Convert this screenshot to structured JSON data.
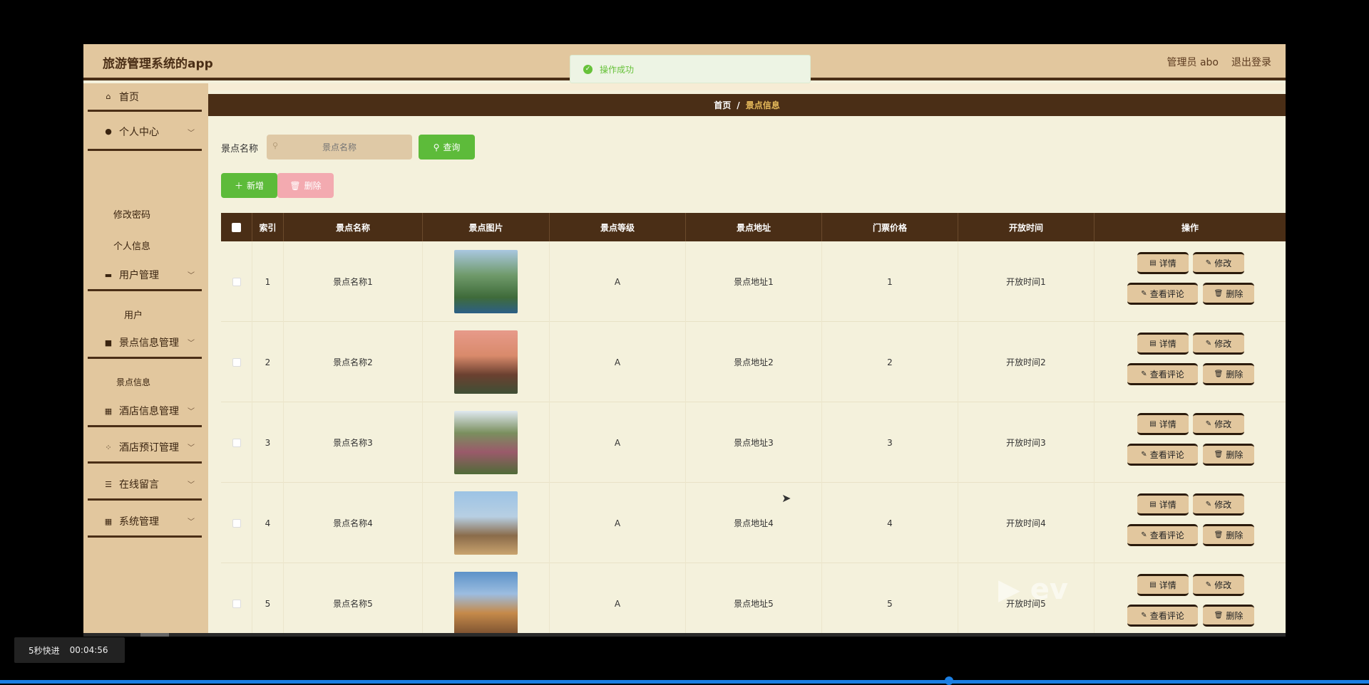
{
  "header": {
    "title": "旅游管理系统的app",
    "user_label": "管理员 abo",
    "logout": "退出登录"
  },
  "toast": {
    "message": "操作成功"
  },
  "sidebar": {
    "items": [
      {
        "label": "首页",
        "icon": "home-icon"
      },
      {
        "label": "个人中心",
        "icon": "user-icon",
        "children": [
          "修改密码",
          "个人信息"
        ]
      },
      {
        "label": "用户管理",
        "icon": "chat-icon",
        "children": [
          "用户"
        ]
      },
      {
        "label": "景点信息管理",
        "icon": "bag-icon",
        "children": [
          "景点信息"
        ]
      },
      {
        "label": "酒店信息管理",
        "icon": "grid-icon"
      },
      {
        "label": "酒店预订管理",
        "icon": "apps-icon"
      },
      {
        "label": "在线留言",
        "icon": "list-icon"
      },
      {
        "label": "系统管理",
        "icon": "grid-icon"
      }
    ]
  },
  "breadcrumb": {
    "home": "首页",
    "sep": "/",
    "current": "景点信息"
  },
  "search": {
    "label": "景点名称",
    "placeholder": "景点名称",
    "button": "查询"
  },
  "actions": {
    "add": "新增",
    "delete": "删除"
  },
  "table": {
    "headers": [
      "索引",
      "景点名称",
      "景点图片",
      "景点等级",
      "景点地址",
      "门票价格",
      "开放时间",
      "操作"
    ],
    "ops": {
      "detail": "详情",
      "edit": "修改",
      "comments": "查看评论",
      "delete": "删除"
    },
    "rows": [
      {
        "index": "1",
        "name": "景点名称1",
        "grade": "A",
        "address": "景点地址1",
        "price": "1",
        "open": "开放时间1"
      },
      {
        "index": "2",
        "name": "景点名称2",
        "grade": "A",
        "address": "景点地址2",
        "price": "2",
        "open": "开放时间2"
      },
      {
        "index": "3",
        "name": "景点名称3",
        "grade": "A",
        "address": "景点地址3",
        "price": "3",
        "open": "开放时间3"
      },
      {
        "index": "4",
        "name": "景点名称4",
        "grade": "A",
        "address": "景点地址4",
        "price": "4",
        "open": "开放时间4"
      },
      {
        "index": "5",
        "name": "景点名称5",
        "grade": "A",
        "address": "景点地址5",
        "price": "5",
        "open": "开放时间5"
      }
    ]
  },
  "player": {
    "speed_label": "5秒快进",
    "time": "00:04:56"
  },
  "colors": {
    "accent": "#4a2e16",
    "tan": "#e2c79e",
    "green": "#5dbb3a"
  }
}
